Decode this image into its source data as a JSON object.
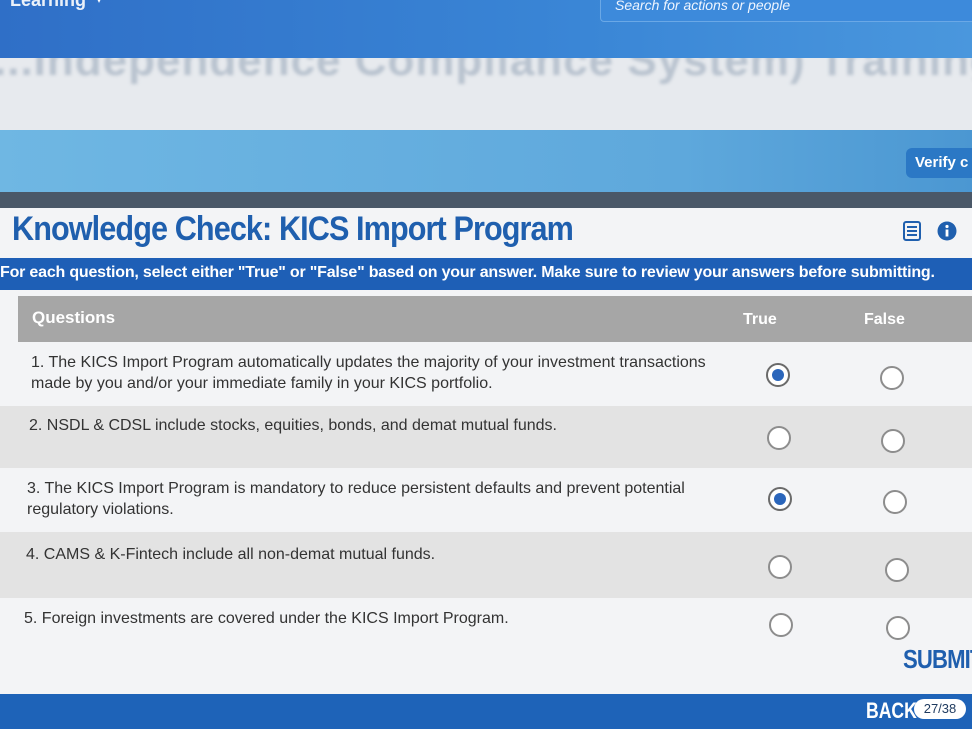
{
  "app": {
    "brand": "Learning",
    "search_placeholder": "Search for actions or people",
    "course_title": "...Independence Compliance System) Training"
  },
  "header": {
    "verify_label": "Verify c"
  },
  "knowledge_check": {
    "title": "Knowledge Check: KICS Import Program",
    "instructions": "For each question, select either \"True\" or \"False\" based on your answer. Make sure to review your answers before submitting.",
    "columns": {
      "questions": "Questions",
      "true": "True",
      "false": "False"
    },
    "questions": [
      {
        "text": "1. The KICS Import Program automatically updates the majority of your investment transactions made by you and/or your immediate family in your KICS portfolio.",
        "selected": "true"
      },
      {
        "text": "2. NSDL & CDSL include stocks, equities, bonds, and demat mutual funds.",
        "selected": "none"
      },
      {
        "text": "3. The KICS Import Program is mandatory to reduce persistent defaults and prevent potential regulatory violations.",
        "selected": "true"
      },
      {
        "text": "4. CAMS & K-Fintech include all non-demat mutual funds.",
        "selected": "none"
      },
      {
        "text": "5. Foreign investments are covered under the KICS Import Program.",
        "selected": "none"
      }
    ],
    "submit_label": "SUBMIT"
  },
  "footer": {
    "back_label": "BACK",
    "page_indicator": "27/38"
  },
  "colors": {
    "accent": "#1f5fae",
    "footer_bg": "#1e63b8",
    "table_header_bg": "#a6a6a6",
    "radio_fill": "#2b66bb"
  }
}
